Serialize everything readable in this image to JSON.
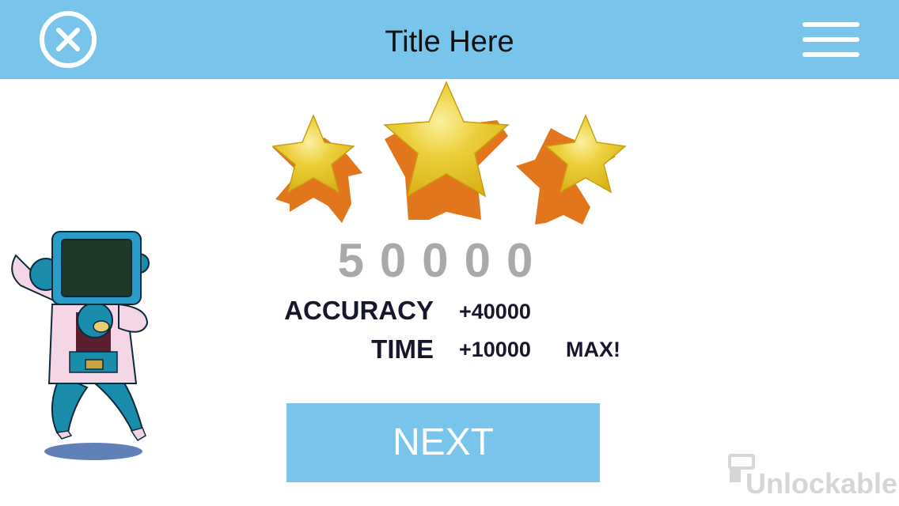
{
  "header": {
    "title": "Title Here",
    "close_icon": "close-circle-icon",
    "menu_icon": "hamburger-menu-icon",
    "background_color": "#78c4ea"
  },
  "result": {
    "stars_earned": 3,
    "stars_total": 3,
    "score": "50000",
    "rows": [
      {
        "label": "ACCURACY",
        "value": "+40000",
        "badge": ""
      },
      {
        "label": "TIME",
        "value": "+10000",
        "badge": "MAX!"
      }
    ]
  },
  "next_button": {
    "label": "NEXT",
    "color": "#78c4ea"
  },
  "watermark": {
    "text": "Unlockable"
  },
  "colors": {
    "star_gold": "#e8c42a",
    "star_side": "#e2761c",
    "score_gray": "#a9a9a9",
    "text_dark": "#16162c"
  }
}
